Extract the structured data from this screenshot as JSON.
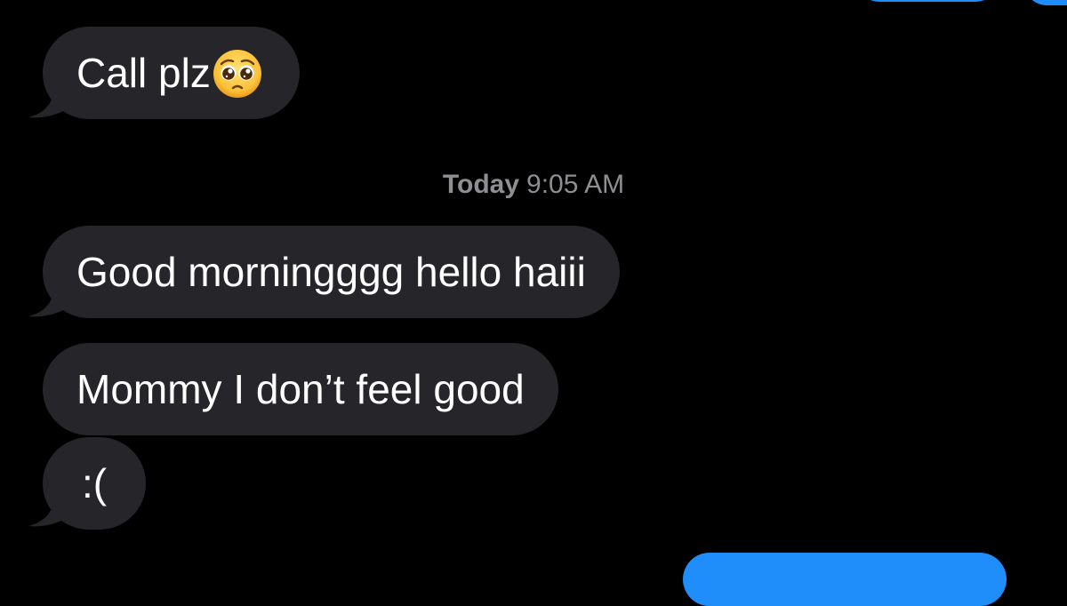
{
  "conversation": {
    "messages_before": [
      {
        "text": "Call plz",
        "emoji": "pleading-face"
      }
    ],
    "timestamp": {
      "day": "Today",
      "time": "9:05 AM"
    },
    "messages_after": [
      {
        "text": "Good morningggg hello haiii"
      },
      {
        "text": "Mommy I don’t feel good"
      },
      {
        "text": ":("
      }
    ]
  },
  "colors": {
    "background": "#000000",
    "incoming_bubble": "#26252a",
    "outgoing_bubble": "#1f8efa",
    "timestamp_text": "#8e8e93"
  },
  "icons": [
    "pleading-face-emoji"
  ]
}
